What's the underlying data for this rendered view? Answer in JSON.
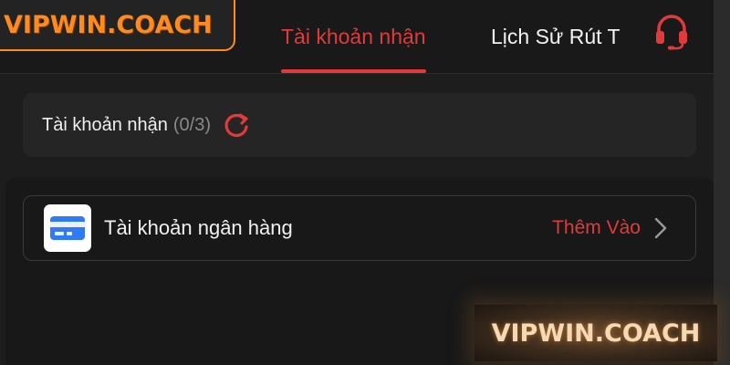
{
  "brand": {
    "logo_text": "VIPWIN.COACH",
    "accent_color": "#e23a3a",
    "logo_color": "#ff8a1f"
  },
  "header": {
    "tabs": [
      {
        "label": "Tài khoản nhận",
        "active": true
      },
      {
        "label": "Lịch Sử Rút T",
        "active": false
      }
    ],
    "support_icon": "headset-icon"
  },
  "accounts": {
    "title": "Tài khoản nhận",
    "count": "(0/3)",
    "refresh_icon": "refresh-icon"
  },
  "bank": {
    "icon": "credit-card-icon",
    "label": "Tài khoản ngân hàng",
    "action": "Thêm Vào",
    "chevron_icon": "chevron-right-icon"
  },
  "watermark": {
    "text": "VIPWIN.COACH"
  }
}
